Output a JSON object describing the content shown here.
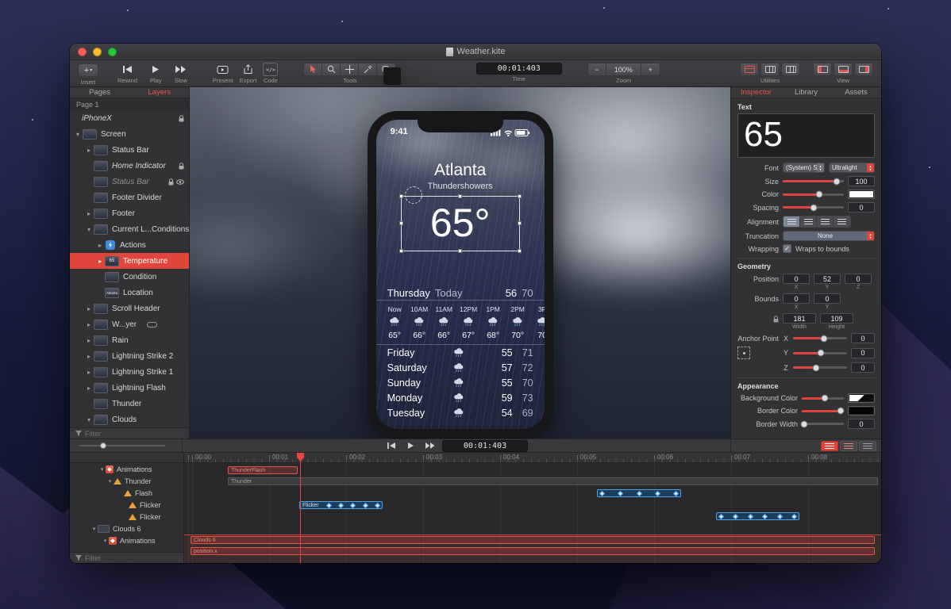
{
  "window": {
    "title": "Weather.kite"
  },
  "colors": {
    "accent_red": "#e0453c",
    "keyframe_blue": "#4aa3e8",
    "selected_layer": "#e0453c"
  },
  "icons": {
    "chevron_right": "▸",
    "chevron_down": "▾",
    "caret_up": "▴",
    "caret_down": "▾",
    "check": "✓",
    "plus": "+",
    "minus": "−"
  },
  "toolbar": {
    "insert_label": "Insert",
    "rewind_label": "Rewind",
    "play_label": "Play",
    "slow_label": "Slow",
    "present_label": "Present",
    "export_label": "Export",
    "code_label": "Code",
    "tools_label": "Tools",
    "time_label": "Time",
    "time_value": "00:01:403",
    "zoom_label": "Zoom",
    "zoom_value": "100%",
    "zoom_minus": "−",
    "zoom_plus": "+",
    "utilities_label": "Utilities",
    "view_label": "View",
    "code_glyph": "</>"
  },
  "left_panel": {
    "tabs": {
      "pages": "Pages",
      "layers": "Layers"
    },
    "page_title": "Page 1",
    "filter_placeholder": "Filter",
    "layers": [
      {
        "label": "iPhoneX"
      },
      {
        "label": "Screen"
      },
      {
        "label": "Status Bar"
      },
      {
        "label": "Home Indicator"
      },
      {
        "label": "Status Bar"
      },
      {
        "label": "Footer Divider"
      },
      {
        "label": "Footer"
      },
      {
        "label": "Current L...Conditions"
      },
      {
        "label": "Actions"
      },
      {
        "label": "Temperature",
        "thumb": "65"
      },
      {
        "label": "Condition"
      },
      {
        "label": "Location",
        "thumb": "Atlanta"
      },
      {
        "label": "Scroll Header"
      },
      {
        "label": "W...yer"
      },
      {
        "label": "Rain"
      },
      {
        "label": "Lightning Strike 2"
      },
      {
        "label": "Lightning Strike 1"
      },
      {
        "label": "Lightning Flash"
      },
      {
        "label": "Thunder"
      },
      {
        "label": "Clouds"
      }
    ]
  },
  "canvas": {
    "status_time": "9:41",
    "city": "Atlanta",
    "condition": "Thundershowers",
    "temperature": "65°",
    "today": {
      "day": "Thursday",
      "label": "Today",
      "high": "56",
      "low": "70"
    },
    "hourly": [
      {
        "t": "Now",
        "temp": "65°"
      },
      {
        "t": "10AM",
        "temp": "66°"
      },
      {
        "t": "11AM",
        "temp": "66°"
      },
      {
        "t": "12PM",
        "temp": "67°"
      },
      {
        "t": "1PM",
        "temp": "68°"
      },
      {
        "t": "2PM",
        "temp": "70°"
      },
      {
        "t": "3P",
        "temp": "70"
      }
    ],
    "daily": [
      {
        "day": "Friday",
        "high": "55",
        "low": "71"
      },
      {
        "day": "Saturday",
        "high": "57",
        "low": "72"
      },
      {
        "day": "Sunday",
        "high": "55",
        "low": "70"
      },
      {
        "day": "Monday",
        "high": "59",
        "low": "73"
      },
      {
        "day": "Tuesday",
        "high": "54",
        "low": "69"
      }
    ],
    "playback_time": "00:01:403"
  },
  "inspector": {
    "tabs": {
      "inspector": "Inspector",
      "library": "Library",
      "assets": "Assets"
    },
    "text": {
      "section": "Text",
      "preview": "65",
      "font_label": "Font",
      "font_family": "(System) San...",
      "font_weight": "Ultralight",
      "size_label": "Size",
      "size_value": "100",
      "color_label": "Color",
      "spacing_label": "Spacing",
      "spacing_value": "0",
      "alignment_label": "Alignment",
      "truncation_label": "Truncation",
      "truncation_value": "None",
      "wrapping_label": "Wrapping",
      "wrapping_checkbox": "Wraps to bounds"
    },
    "geometry": {
      "section": "Geometry",
      "position_label": "Position",
      "position": {
        "x": "0",
        "y": "52",
        "z": "0"
      },
      "axis": {
        "x": "X",
        "y": "Y",
        "z": "Z"
      },
      "bounds_label": "Bounds",
      "bounds": {
        "x": "0",
        "y": "0",
        "width": "181",
        "height": "109"
      },
      "width_label": "Width",
      "height_label": "Height",
      "anchor_label": "Anchor Point",
      "anchor": {
        "x": "0",
        "y": "0",
        "z": "0"
      }
    },
    "appearance": {
      "section": "Appearance",
      "background_label": "Background Color",
      "border_color_label": "Border Color",
      "border_width_label": "Border Width",
      "border_width_value": "0"
    }
  },
  "timeline": {
    "filter_placeholder": "Filter",
    "ticks": [
      "00:00",
      "00:01",
      "00:02",
      "00:03",
      "00:04",
      "00:05",
      "00:06",
      "00:07",
      "00:08"
    ],
    "tree": [
      {
        "label": "Animations"
      },
      {
        "label": "Thunder"
      },
      {
        "label": "Flash"
      },
      {
        "label": "Flicker"
      },
      {
        "label": "Flicker"
      },
      {
        "label": "Clouds 6"
      },
      {
        "label": "Animations"
      }
    ],
    "tracks": {
      "thunderflash_label": "ThunderFlash",
      "thunder_label": "Thunder",
      "flicker_label": "Flicker",
      "clouds_label": "Clouds 6",
      "positionx_label": "position.x"
    }
  }
}
